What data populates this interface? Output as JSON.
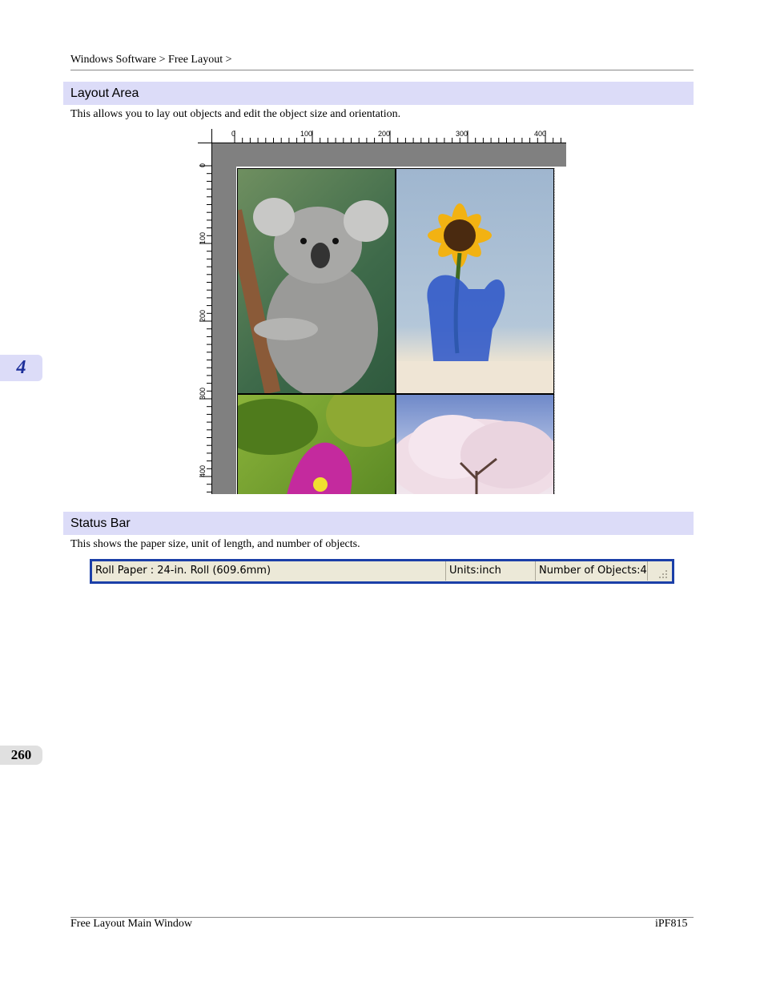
{
  "header": {
    "breadcrumb_part1": "Windows Software",
    "breadcrumb_sep1": ">",
    "breadcrumb_part2": "Free Layout",
    "breadcrumb_sep2": ">"
  },
  "chapter_tab": "4",
  "page_number": "260",
  "sections": {
    "layout_area": {
      "title": "Layout Area",
      "description": "This allows you to lay out objects and edit the object size and orientation."
    },
    "status_bar": {
      "title": "Status Bar",
      "description": "This shows the paper size, unit of length, and number of objects."
    }
  },
  "layout_screenshot": {
    "ruler_top_labels": [
      "0",
      "100",
      "200",
      "300",
      "400"
    ],
    "ruler_left_labels": [
      "0",
      "100",
      "200",
      "300",
      "400"
    ],
    "photos": [
      "koala",
      "sunflower",
      "bougainvillea",
      "cherry-blossom-tree"
    ]
  },
  "status_bar_screenshot": {
    "paper": "Roll Paper : 24-in. Roll (609.6mm)",
    "units": "Units:inch",
    "objects": "Number of Objects:4"
  },
  "footer": {
    "left": "Free Layout Main Window",
    "right": "iPF815"
  },
  "colors": {
    "section_bar": "#dcdcf8",
    "chapter_tab_text": "#1d2f9a",
    "status_frame": "#1b3fa8"
  }
}
